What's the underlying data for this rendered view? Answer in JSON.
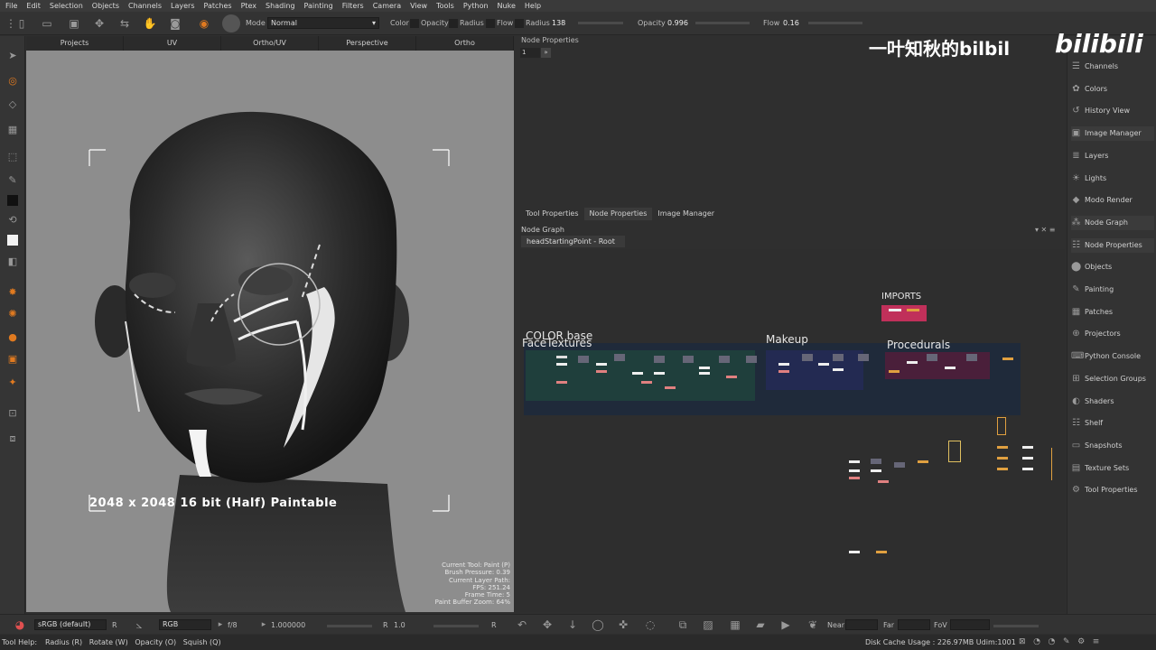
{
  "menu": [
    "File",
    "Edit",
    "Selection",
    "Objects",
    "Channels",
    "Layers",
    "Patches",
    "Ptex",
    "Shading",
    "Painting",
    "Filters",
    "Camera",
    "View",
    "Tools",
    "Python",
    "Nuke",
    "Help"
  ],
  "toolbar": {
    "mode_label": "Mode",
    "mode_value": "Normal",
    "color_label": "Color",
    "opacity_label": "Opacity",
    "radius_label": "Radius",
    "flow_label": "Flow",
    "radius_value_label": "Radius",
    "radius_value": "138",
    "opacity_value_label": "Opacity",
    "opacity_value": "0.996",
    "flow_value_label": "Flow",
    "flow_value": "0.16"
  },
  "viewport_tabs": [
    "Projects",
    "UV",
    "Ortho/UV",
    "Perspective",
    "Ortho"
  ],
  "viewport": {
    "paintable_text": "2048 x 2048 16 bit (Half) Paintable",
    "stats": [
      "Current Tool: Paint (P)",
      "Brush Pressure: 0.39",
      "Current Layer Path:",
      "FPS: 251.24",
      "Frame Time: 5",
      "Paint Buffer Zoom: 64%"
    ]
  },
  "node_properties": {
    "title": "Node Properties",
    "field_value": "1"
  },
  "mid_tabs": [
    "Tool Properties",
    "Node Properties",
    "Image Manager"
  ],
  "node_graph": {
    "title": "Node Graph",
    "breadcrumb": "headStartingPoint - Root",
    "groups": [
      "COLOR base",
      "FaceTextures",
      "Makeup",
      "Procedurals",
      "IMPORTS"
    ]
  },
  "right_panel": [
    {
      "label": "Channels",
      "icon": "channels-icon"
    },
    {
      "label": "Colors",
      "icon": "colors-icon"
    },
    {
      "label": "History View",
      "icon": "history-icon"
    },
    {
      "label": "Image Manager",
      "icon": "image-manager-icon"
    },
    {
      "label": "Layers",
      "icon": "layers-icon"
    },
    {
      "label": "Lights",
      "icon": "lights-icon"
    },
    {
      "label": "Modo Render",
      "icon": "modo-render-icon"
    },
    {
      "label": "Node Graph",
      "icon": "node-graph-icon"
    },
    {
      "label": "Node Properties",
      "icon": "node-properties-icon"
    },
    {
      "label": "Objects",
      "icon": "objects-icon"
    },
    {
      "label": "Painting",
      "icon": "painting-icon"
    },
    {
      "label": "Patches",
      "icon": "patches-icon"
    },
    {
      "label": "Projectors",
      "icon": "projectors-icon"
    },
    {
      "label": "Python Console",
      "icon": "python-console-icon"
    },
    {
      "label": "Selection Groups",
      "icon": "selection-groups-icon"
    },
    {
      "label": "Shaders",
      "icon": "shaders-icon"
    },
    {
      "label": "Shelf",
      "icon": "shelf-icon"
    },
    {
      "label": "Snapshots",
      "icon": "snapshots-icon"
    },
    {
      "label": "Texture Sets",
      "icon": "texture-sets-icon"
    },
    {
      "label": "Tool Properties",
      "icon": "tool-properties-icon"
    }
  ],
  "bottom_bar": {
    "colorspace": "sRGB (default)",
    "r_label": "R",
    "channel": "RGB",
    "fstop": "f/8",
    "exposure": "1.000000",
    "r2_label": "R",
    "gamma": "1.0",
    "r3_label": "R",
    "near_label": "Near",
    "far_label": "Far",
    "fov_label": "FoV"
  },
  "status_bar": {
    "tool_help": "Tool Help:",
    "hints": "Radius (R)   Rotate (W)   Opacity (O)   Squish (Q)",
    "disk_cache": "Disk Cache Usage : 226.97MB Udim:1001"
  },
  "watermark": {
    "text": "一叶知秋的bilbil",
    "logo": "bilibili"
  },
  "colors": {
    "imports_node": "#c0305a",
    "face_group": "#1f3f3c",
    "makeup_group": "#232a52",
    "procedurals_group": "#4a1f3a",
    "outer_group": "#1f2a3a"
  }
}
